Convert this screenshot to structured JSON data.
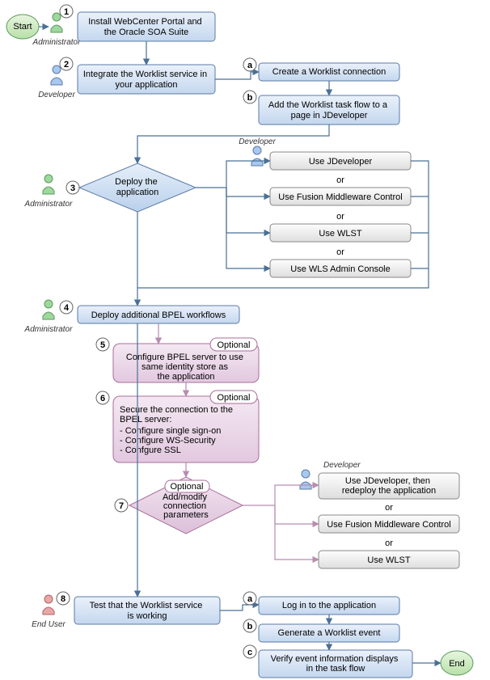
{
  "start": "Start",
  "end": "End",
  "roles": {
    "admin": "Administrator",
    "dev": "Developer",
    "user": "End User"
  },
  "steps": {
    "s1": {
      "num": "1",
      "text": "Install WebCenter Portal and the Oracle SOA Suite"
    },
    "s2": {
      "num": "2",
      "text": "Integrate the Worklist service in your application"
    },
    "s2a": {
      "num": "a",
      "text": "Create a Worklist connection"
    },
    "s2b": {
      "num": "b",
      "text": "Add the Worklist task flow to a page in JDeveloper"
    },
    "s3": {
      "num": "3",
      "text": "Deploy the application"
    },
    "deploy_opts": {
      "a": "Use JDeveloper",
      "b": "Use Fusion Middleware Control",
      "c": "Use WLST",
      "d": "Use WLS Admin Console"
    },
    "or": "or",
    "s4": {
      "num": "4",
      "text": "Deploy additional BPEL workflows"
    },
    "optional": "Optional",
    "s5": {
      "num": "5",
      "text_l1": "Configure BPEL server to use",
      "text_l2": "same identity store as",
      "text_l3": "the application"
    },
    "s6": {
      "num": "6",
      "title_l1": "Secure the connection to the",
      "title_l2": "BPEL server:",
      "b1": "-  Configure single sign-on",
      "b2": "-  Configure WS-Security",
      "b3": "-  Confgure SSL"
    },
    "s7": {
      "num": "7",
      "text_l1": "Add/modify",
      "text_l2": "connection",
      "text_l3": "parameters"
    },
    "conn_opts": {
      "a_l1": "Use JDeveloper, then",
      "a_l2": "redeploy the application",
      "b": "Use Fusion Middleware Control",
      "c": "Use WLST"
    },
    "s8": {
      "num": "8",
      "text": "Test that  the Worklist service is working"
    },
    "s8a": {
      "num": "a",
      "text": "Log in to the application"
    },
    "s8b": {
      "num": "b",
      "text": "Generate a Worklist event"
    },
    "s8c": {
      "num": "c",
      "text_l1": "Verify event information displays",
      "text_l2": "in the task flow"
    }
  }
}
